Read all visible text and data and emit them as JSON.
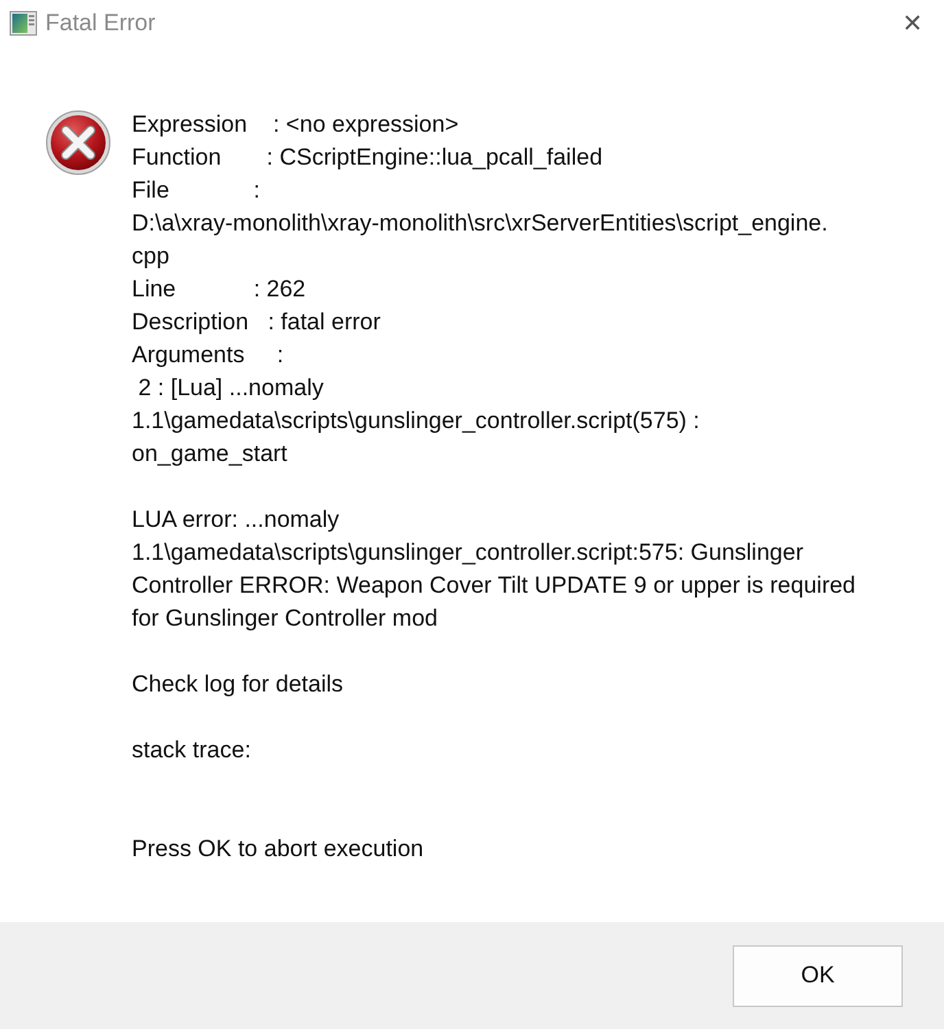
{
  "window": {
    "title": "Fatal Error",
    "close": "✕"
  },
  "message": {
    "paragraphs": [
      {
        "lines": [
          "Expression    : <no expression>",
          "Function       : CScriptEngine::lua_pcall_failed",
          "File             :",
          "D:\\a\\xray-monolith\\xray-monolith\\src\\xrServerEntities\\script_engine.",
          "cpp",
          "Line            : 262",
          "Description   : fatal error",
          "Arguments     :",
          " 2 : [Lua] ...nomaly",
          "1.1\\gamedata\\scripts\\gunslinger_controller.script(575) :",
          "on_game_start"
        ]
      },
      {
        "lines": [
          "LUA error: ...nomaly",
          "1.1\\gamedata\\scripts\\gunslinger_controller.script:575: Gunslinger",
          "Controller ERROR: Weapon Cover Tilt UPDATE 9 or upper is required",
          "for Gunslinger Controller mod"
        ]
      },
      {
        "lines": [
          "Check log for details"
        ]
      },
      {
        "lines": [
          "stack trace:"
        ]
      }
    ],
    "prompt": "Press OK to abort execution"
  },
  "buttons": [
    "OK"
  ]
}
